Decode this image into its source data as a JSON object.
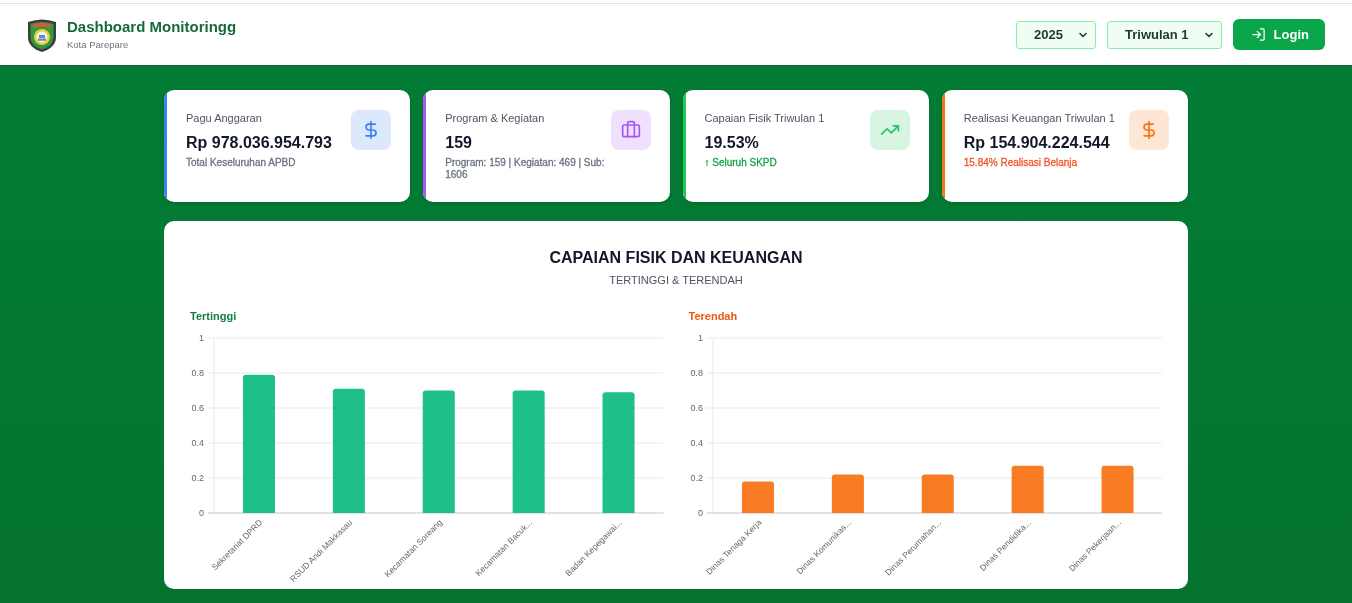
{
  "header": {
    "title": "Dashboard Monitoringg",
    "subtitle": "Kota Parepare",
    "filters": [
      {
        "value": "2025"
      },
      {
        "value": "Triwulan 1"
      }
    ],
    "login_button": {
      "label": "Login"
    }
  },
  "stat_cards": [
    {
      "kind": "dollar",
      "title": "Pagu Anggaran",
      "value": "Rp 978.036.954.793",
      "note": {
        "text": "Total Keseluruhan APBD",
        "color": "#6b7280"
      },
      "color": "#3b82f6"
    },
    {
      "kind": "briefcase",
      "title": "Program & Kegiatan",
      "value": "159",
      "note": {
        "text": "Program: 159 | Kegiatan: 469 | Sub: 1606",
        "color": "#6b7280"
      },
      "color": "#a855f7"
    },
    {
      "kind": "trend",
      "title": "Capaian Fisik Triwulan 1",
      "value": "19.53%",
      "note": {
        "text": "↑ Seluruh SKPD",
        "color": "#16a34a"
      },
      "color": "#22c55e"
    },
    {
      "kind": "dollar",
      "title": "Realisasi Keuangan Triwulan 1",
      "value": "Rp 154.904.224.544",
      "note": {
        "text": "15.84% Realisasi Belanja",
        "color": "#f0552a"
      },
      "color": "#f97316"
    }
  ],
  "chart_panel": {
    "title": "CAPAIAN FISIK DAN KEUANGAN",
    "subtitle": "TERTINGGI & TERENDAH",
    "charts": [
      {
        "heading": "Tertinggi",
        "color": "#15803d",
        "chart_data": {
          "type": "bar",
          "categories": [
            "Sekretariat DPRD",
            "RSUD Andi Makkasau",
            "Kecamatan Soreang",
            "Kecamatan Bacuk...",
            "Badan Kepegawai..."
          ],
          "series": [
            {
              "color": "#1fbf88",
              "values": [
                0.79,
                0.71,
                0.7,
                0.7,
                0.69
              ]
            }
          ],
          "ylim": [
            0,
            1
          ],
          "yticks": [
            0,
            0.2,
            0.4,
            0.6,
            0.8,
            1
          ],
          "grid": true
        }
      },
      {
        "heading": "Terendah",
        "color": "#ea580c",
        "chart_data": {
          "type": "bar",
          "categories": [
            "Dinas Tenaga Kerja",
            "Dinas Komunikas...",
            "Dinas Perumahan...",
            "Dinas Pendidika...",
            "Dinas Pekerjaan..."
          ],
          "series": [
            {
              "color": "#f97b24",
              "values": [
                0.18,
                0.22,
                0.22,
                0.27,
                0.27
              ]
            }
          ],
          "ylim": [
            0,
            1
          ],
          "yticks": [
            0,
            0.2,
            0.4,
            0.6,
            0.8,
            1
          ],
          "grid": true
        }
      }
    ]
  }
}
